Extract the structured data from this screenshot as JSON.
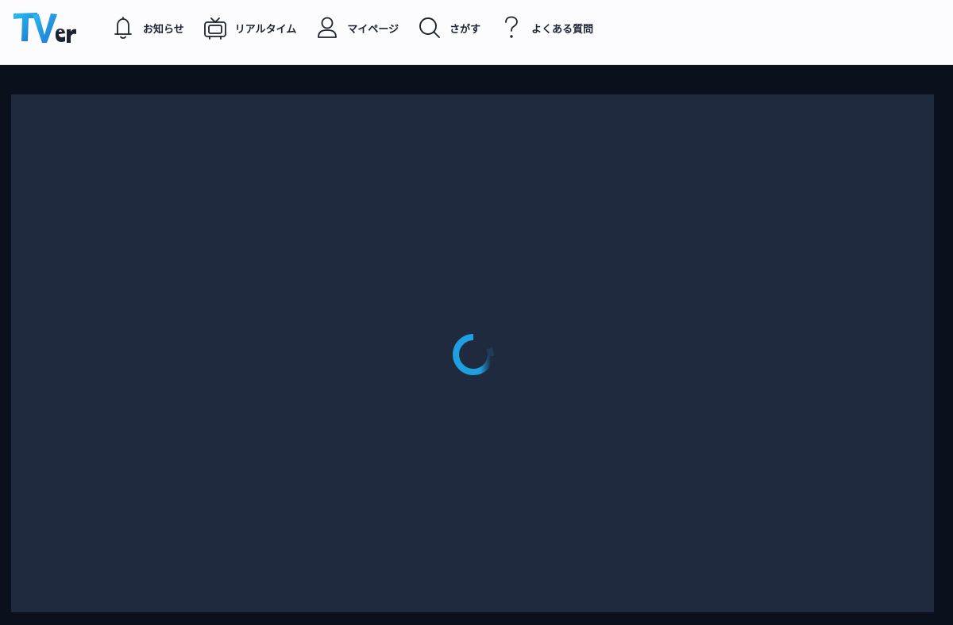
{
  "brand": {
    "logo_text": "TVer",
    "logo_color_start": "#22b2ea",
    "logo_color_end": "#1d6fd1",
    "logo_tail_color": "#1c2230"
  },
  "nav": {
    "items": [
      {
        "label": "お知らせ",
        "icon": "bell-icon"
      },
      {
        "label": "リアルタイム",
        "icon": "tv-icon"
      },
      {
        "label": "マイページ",
        "icon": "user-icon"
      },
      {
        "label": "さがす",
        "icon": "search-icon"
      },
      {
        "label": "よくある質問",
        "icon": "question-icon"
      }
    ]
  },
  "player": {
    "state": "loading",
    "spinner_color": "#1f9fe0",
    "background": "#1f2a3e"
  },
  "colors": {
    "header_bg": "#fcfcfe",
    "page_bg": "#0a111d",
    "text": "#1c2230"
  }
}
